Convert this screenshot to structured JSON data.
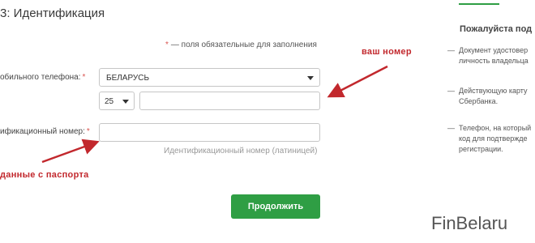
{
  "step": {
    "title": "3: Идентификация"
  },
  "form": {
    "required_note": "— поля обязательные для заполнения",
    "required_star": "*",
    "phone_label": "обильного телефона:",
    "country_value": "БЕЛАРУСЬ",
    "code_value": "25",
    "phone_value": "",
    "id_label": "ификационный номер:",
    "id_value": "",
    "id_hint": "Идентификационный номер (латиницей)",
    "continue_label": "Продолжить"
  },
  "annotations": {
    "phone_hint": "ваш номер",
    "passport_hint": "данные с паспорта",
    "color": "#c2282d"
  },
  "sidebar": {
    "title": "Пожалуйста под",
    "items": [
      {
        "line1": "Документ удостовер",
        "line2": "личность владельца"
      },
      {
        "line1": "Действующую карту",
        "line2": "Сбербанка."
      },
      {
        "line1": "Телефон, на который",
        "line2": "код для подтвержде",
        "line3": "регистрации."
      }
    ]
  },
  "watermark": "FinBelaru",
  "colors": {
    "accent": "#2f9e44",
    "required": "#d9534f"
  }
}
